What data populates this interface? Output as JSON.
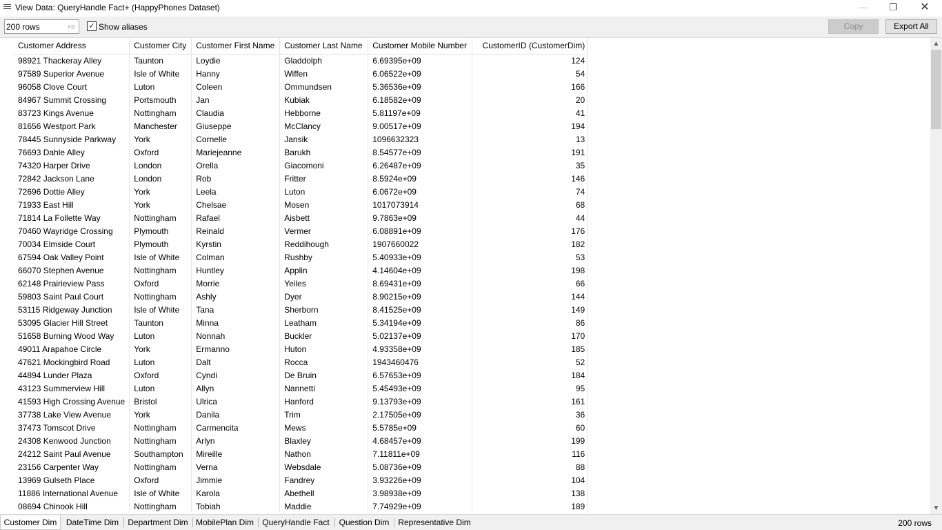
{
  "window": {
    "title": "View Data:  QueryHandle Fact+ (HappyPhones Dataset)",
    "icon": "list-icon",
    "controls": {
      "minimize": "—",
      "restore": "❐",
      "close": "✕"
    }
  },
  "toolbar": {
    "rows_value": "200 rows",
    "show_aliases_label": "Show aliases",
    "show_aliases_checked": true,
    "check_mark": "✓",
    "go_arrow": "⇨",
    "copy_label": "Copy",
    "export_label": "Export All"
  },
  "table": {
    "columns": [
      "Customer Address",
      "Customer City",
      "Customer First Name",
      "Customer Last Name",
      "Customer Mobile Number",
      "CustomerID (CustomerDim)"
    ],
    "rows": [
      [
        "98921 Thackeray Alley",
        "Taunton",
        "Loydie",
        "Gladdolph",
        "6.69395e+09",
        "124"
      ],
      [
        "97589 Superior Avenue",
        "Isle of White",
        "Hanny",
        "Wiffen",
        "6.06522e+09",
        "54"
      ],
      [
        "96058 Clove Court",
        "Luton",
        "Coleen",
        "Ommundsen",
        "5.36536e+09",
        "166"
      ],
      [
        "84967 Summit Crossing",
        "Portsmouth",
        "Jan",
        "Kubiak",
        "6.18582e+09",
        "20"
      ],
      [
        "83723 Kings Avenue",
        "Nottingham",
        "Claudia",
        "Hebborne",
        "5.81197e+09",
        "41"
      ],
      [
        "81656 Westport Park",
        "Manchester",
        "Giuseppe",
        "McClancy",
        "9.00517e+09",
        "194"
      ],
      [
        "78445 Sunnyside Parkway",
        "York",
        "Cornelle",
        "Jansik",
        "1096632323",
        "13"
      ],
      [
        "76693 Dahle Alley",
        "Oxford",
        "Mariejeanne",
        "Barukh",
        "8.54577e+09",
        "191"
      ],
      [
        "74320 Harper Drive",
        "London",
        "Orella",
        "Giacomoni",
        "6.26487e+09",
        "35"
      ],
      [
        "72842 Jackson Lane",
        "London",
        "Rob",
        "Fritter",
        "8.5924e+09",
        "146"
      ],
      [
        "72696 Dottie Alley",
        "York",
        "Leela",
        "Luton",
        "6.0672e+09",
        "74"
      ],
      [
        "71933 East Hill",
        "York",
        "Chelsae",
        "Mosen",
        "1017073914",
        "68"
      ],
      [
        "71814 La Follette Way",
        "Nottingham",
        "Rafael",
        "Aisbett",
        "9.7863e+09",
        "44"
      ],
      [
        "70460 Wayridge Crossing",
        "Plymouth",
        "Reinald",
        "Vermer",
        "6.08891e+09",
        "176"
      ],
      [
        "70034 Elmside Court",
        "Plymouth",
        "Kyrstin",
        "Reddihough",
        "1907660022",
        "182"
      ],
      [
        "67594 Oak Valley Point",
        "Isle of White",
        "Colman",
        "Rushby",
        "5.40933e+09",
        "53"
      ],
      [
        "66070 Stephen Avenue",
        "Nottingham",
        "Huntley",
        "Applin",
        "4.14604e+09",
        "198"
      ],
      [
        "62148 Prairieview Pass",
        "Oxford",
        "Morrie",
        "Yeiles",
        "8.69431e+09",
        "66"
      ],
      [
        "59803 Saint Paul Court",
        "Nottingham",
        "Ashly",
        "Dyer",
        "8.90215e+09",
        "144"
      ],
      [
        "53115 Ridgeway Junction",
        "Isle of White",
        "Tana",
        "Sherborn",
        "8.41525e+09",
        "149"
      ],
      [
        "53095 Glacier Hill Street",
        "Taunton",
        "Minna",
        "Leatham",
        "5.34194e+09",
        "86"
      ],
      [
        "51658 Burning Wood Way",
        "Luton",
        "Nonnah",
        "Buckler",
        "5.02137e+09",
        "170"
      ],
      [
        "49011 Arapahoe Circle",
        "York",
        "Ermanno",
        "Huton",
        "4.93358e+09",
        "185"
      ],
      [
        "47621 Mockingbird Road",
        "Luton",
        "Dalt",
        "Rocca",
        "1943460476",
        "52"
      ],
      [
        "44894 Lunder Plaza",
        "Oxford",
        "Cyndi",
        "De Bruin",
        "6.57653e+09",
        "184"
      ],
      [
        "43123 Summerview Hill",
        "Luton",
        "Allyn",
        "Nannetti",
        "5.45493e+09",
        "95"
      ],
      [
        "41593 High Crossing Avenue",
        "Bristol",
        "Ulrica",
        "Hanford",
        "9.13793e+09",
        "161"
      ],
      [
        "37738 Lake View Avenue",
        "York",
        "Danila",
        "Trim",
        "2.17505e+09",
        "36"
      ],
      [
        "37473 Tomscot Drive",
        "Nottingham",
        "Carmencita",
        "Mews",
        "5.5785e+09",
        "60"
      ],
      [
        "24308 Kenwood Junction",
        "Nottingham",
        "Arlyn",
        "Blaxley",
        "4.68457e+09",
        "199"
      ],
      [
        "24212 Saint Paul Avenue",
        "Southampton",
        "Mireille",
        "Nathon",
        "7.11811e+09",
        "116"
      ],
      [
        "23156 Carpenter Way",
        "Nottingham",
        "Verna",
        "Websdale",
        "5.08736e+09",
        "88"
      ],
      [
        "13969 Gulseth Place",
        "Oxford",
        "Jimmie",
        "Fandrey",
        "3.93226e+09",
        "104"
      ],
      [
        "11886 International Avenue",
        "Isle of White",
        "Karola",
        "Abethell",
        "3.98938e+09",
        "138"
      ],
      [
        "08694 Chinook Hill",
        "Nottingham",
        "Tobiah",
        "Maddie",
        "7.74929e+09",
        "189"
      ]
    ]
  },
  "scrollbar": {
    "up_arrow": "▲",
    "down_arrow": "▼"
  },
  "tabs": [
    {
      "label": "Customer Dim",
      "active": true
    },
    {
      "label": "DateTime Dim",
      "active": false
    },
    {
      "label": "Department Dim",
      "active": false
    },
    {
      "label": "MobilePlan Dim",
      "active": false
    },
    {
      "label": "QueryHandle Fact",
      "active": false
    },
    {
      "label": "Question Dim",
      "active": false
    },
    {
      "label": "Representative Dim",
      "active": false
    }
  ],
  "status": {
    "row_count": "200 rows"
  }
}
